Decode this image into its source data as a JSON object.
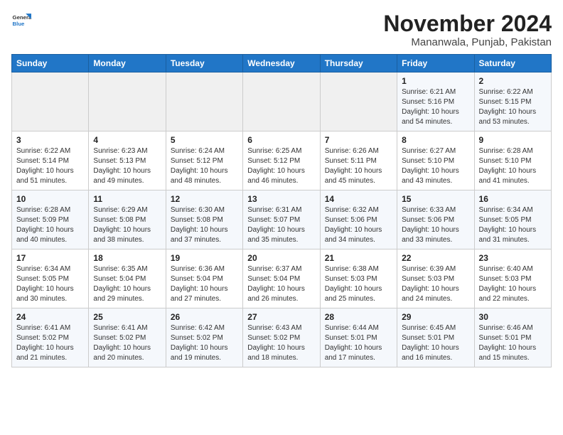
{
  "header": {
    "logo_line1": "General",
    "logo_line2": "Blue",
    "title": "November 2024",
    "subtitle": "Mananwala, Punjab, Pakistan"
  },
  "weekdays": [
    "Sunday",
    "Monday",
    "Tuesday",
    "Wednesday",
    "Thursday",
    "Friday",
    "Saturday"
  ],
  "weeks": [
    [
      {
        "day": "",
        "info": ""
      },
      {
        "day": "",
        "info": ""
      },
      {
        "day": "",
        "info": ""
      },
      {
        "day": "",
        "info": ""
      },
      {
        "day": "",
        "info": ""
      },
      {
        "day": "1",
        "info": "Sunrise: 6:21 AM\nSunset: 5:16 PM\nDaylight: 10 hours\nand 54 minutes."
      },
      {
        "day": "2",
        "info": "Sunrise: 6:22 AM\nSunset: 5:15 PM\nDaylight: 10 hours\nand 53 minutes."
      }
    ],
    [
      {
        "day": "3",
        "info": "Sunrise: 6:22 AM\nSunset: 5:14 PM\nDaylight: 10 hours\nand 51 minutes."
      },
      {
        "day": "4",
        "info": "Sunrise: 6:23 AM\nSunset: 5:13 PM\nDaylight: 10 hours\nand 49 minutes."
      },
      {
        "day": "5",
        "info": "Sunrise: 6:24 AM\nSunset: 5:12 PM\nDaylight: 10 hours\nand 48 minutes."
      },
      {
        "day": "6",
        "info": "Sunrise: 6:25 AM\nSunset: 5:12 PM\nDaylight: 10 hours\nand 46 minutes."
      },
      {
        "day": "7",
        "info": "Sunrise: 6:26 AM\nSunset: 5:11 PM\nDaylight: 10 hours\nand 45 minutes."
      },
      {
        "day": "8",
        "info": "Sunrise: 6:27 AM\nSunset: 5:10 PM\nDaylight: 10 hours\nand 43 minutes."
      },
      {
        "day": "9",
        "info": "Sunrise: 6:28 AM\nSunset: 5:10 PM\nDaylight: 10 hours\nand 41 minutes."
      }
    ],
    [
      {
        "day": "10",
        "info": "Sunrise: 6:28 AM\nSunset: 5:09 PM\nDaylight: 10 hours\nand 40 minutes."
      },
      {
        "day": "11",
        "info": "Sunrise: 6:29 AM\nSunset: 5:08 PM\nDaylight: 10 hours\nand 38 minutes."
      },
      {
        "day": "12",
        "info": "Sunrise: 6:30 AM\nSunset: 5:08 PM\nDaylight: 10 hours\nand 37 minutes."
      },
      {
        "day": "13",
        "info": "Sunrise: 6:31 AM\nSunset: 5:07 PM\nDaylight: 10 hours\nand 35 minutes."
      },
      {
        "day": "14",
        "info": "Sunrise: 6:32 AM\nSunset: 5:06 PM\nDaylight: 10 hours\nand 34 minutes."
      },
      {
        "day": "15",
        "info": "Sunrise: 6:33 AM\nSunset: 5:06 PM\nDaylight: 10 hours\nand 33 minutes."
      },
      {
        "day": "16",
        "info": "Sunrise: 6:34 AM\nSunset: 5:05 PM\nDaylight: 10 hours\nand 31 minutes."
      }
    ],
    [
      {
        "day": "17",
        "info": "Sunrise: 6:34 AM\nSunset: 5:05 PM\nDaylight: 10 hours\nand 30 minutes."
      },
      {
        "day": "18",
        "info": "Sunrise: 6:35 AM\nSunset: 5:04 PM\nDaylight: 10 hours\nand 29 minutes."
      },
      {
        "day": "19",
        "info": "Sunrise: 6:36 AM\nSunset: 5:04 PM\nDaylight: 10 hours\nand 27 minutes."
      },
      {
        "day": "20",
        "info": "Sunrise: 6:37 AM\nSunset: 5:04 PM\nDaylight: 10 hours\nand 26 minutes."
      },
      {
        "day": "21",
        "info": "Sunrise: 6:38 AM\nSunset: 5:03 PM\nDaylight: 10 hours\nand 25 minutes."
      },
      {
        "day": "22",
        "info": "Sunrise: 6:39 AM\nSunset: 5:03 PM\nDaylight: 10 hours\nand 24 minutes."
      },
      {
        "day": "23",
        "info": "Sunrise: 6:40 AM\nSunset: 5:03 PM\nDaylight: 10 hours\nand 22 minutes."
      }
    ],
    [
      {
        "day": "24",
        "info": "Sunrise: 6:41 AM\nSunset: 5:02 PM\nDaylight: 10 hours\nand 21 minutes."
      },
      {
        "day": "25",
        "info": "Sunrise: 6:41 AM\nSunset: 5:02 PM\nDaylight: 10 hours\nand 20 minutes."
      },
      {
        "day": "26",
        "info": "Sunrise: 6:42 AM\nSunset: 5:02 PM\nDaylight: 10 hours\nand 19 minutes."
      },
      {
        "day": "27",
        "info": "Sunrise: 6:43 AM\nSunset: 5:02 PM\nDaylight: 10 hours\nand 18 minutes."
      },
      {
        "day": "28",
        "info": "Sunrise: 6:44 AM\nSunset: 5:01 PM\nDaylight: 10 hours\nand 17 minutes."
      },
      {
        "day": "29",
        "info": "Sunrise: 6:45 AM\nSunset: 5:01 PM\nDaylight: 10 hours\nand 16 minutes."
      },
      {
        "day": "30",
        "info": "Sunrise: 6:46 AM\nSunset: 5:01 PM\nDaylight: 10 hours\nand 15 minutes."
      }
    ]
  ]
}
